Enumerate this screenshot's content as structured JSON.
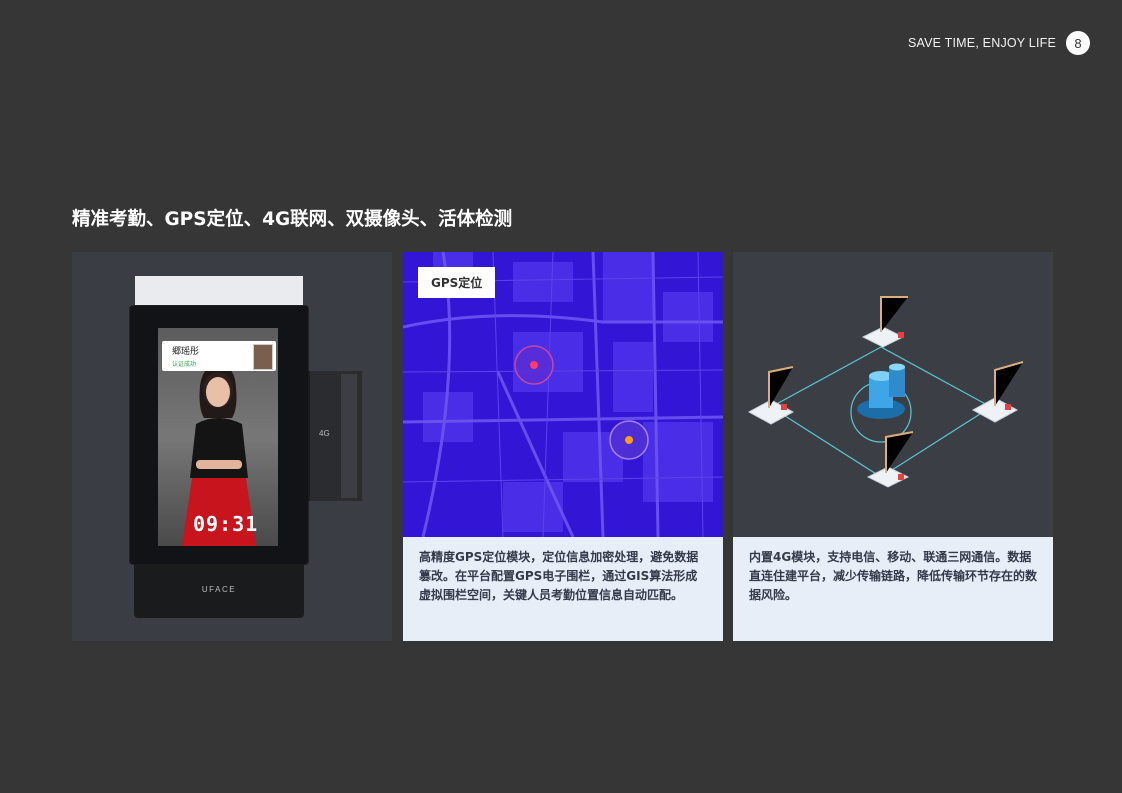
{
  "header": {
    "tagline": "SAVE TIME, ENJOY LIFE",
    "page_number": "8"
  },
  "title": "精准考勤、GPS定位、4G联网、双摄像头、活体检测",
  "device": {
    "brand": "UFACE",
    "person_name": "郷瑶彤",
    "status_text": "认证成功",
    "time": "09:31",
    "network_label": "4G"
  },
  "gps_card": {
    "label": "GPS定位",
    "description": "高精度GPS定位模块，定位信息加密处理，避免数据篡改。在平台配置GPS电子围栏，通过GIS算法形成虚拟围栏空间，关键人员考勤位置信息自动匹配。",
    "markers": [
      {
        "name": "marker-red",
        "color": "#ff3b6b"
      },
      {
        "name": "marker-orange",
        "color": "#ff9a1a"
      }
    ]
  },
  "network_card": {
    "description": "内置4G模块，支持电信、移动、联通三网通信。数据直连住建平台，减少传输链路，降低传输环节存在的数据风险。"
  },
  "colors": {
    "background": "#363636",
    "map_blue": "#3315d6",
    "card_bg": "#e8eef8",
    "network_line": "#5fd6e0"
  }
}
